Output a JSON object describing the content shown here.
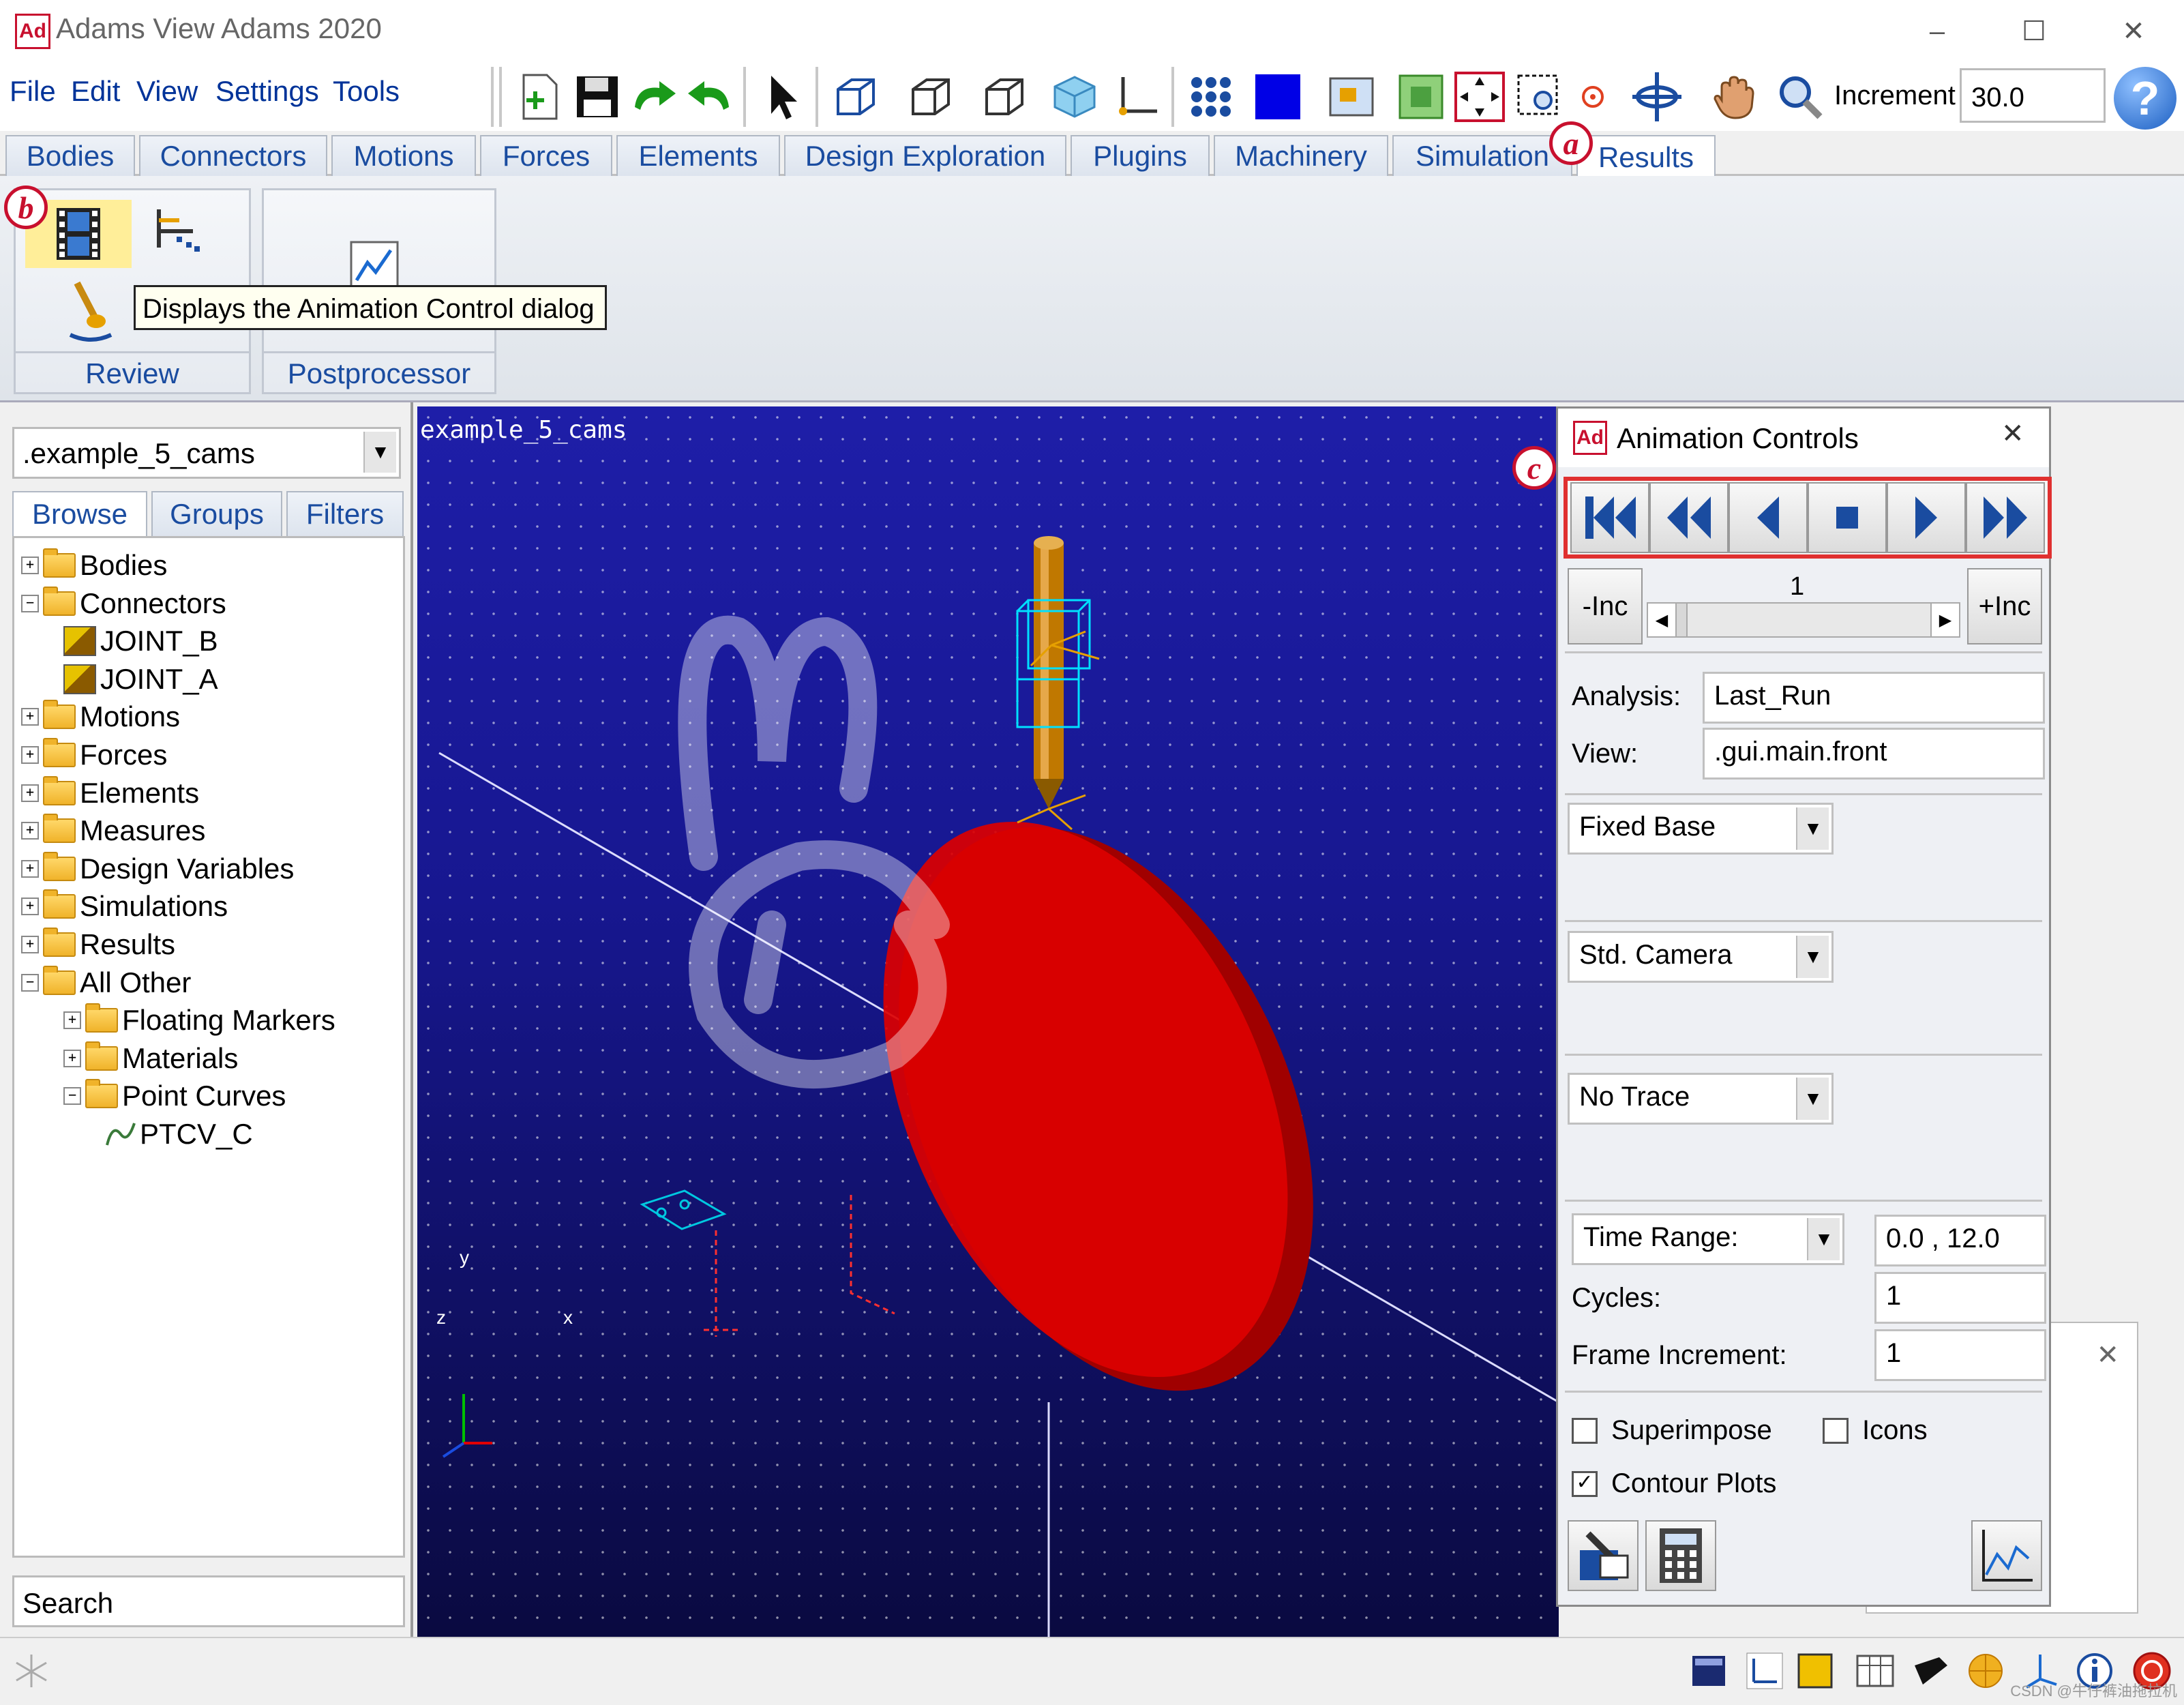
{
  "window": {
    "title": "Adams View Adams 2020",
    "app_badge": "Ad"
  },
  "menu": [
    "File",
    "Edit",
    "View",
    "Settings",
    "Tools"
  ],
  "toolbar": {
    "increment_label": "Increment",
    "increment_value": "30.0"
  },
  "ribbon_tabs": [
    "Bodies",
    "Connectors",
    "Motions",
    "Forces",
    "Elements",
    "Design Exploration",
    "Plugins",
    "Machinery",
    "Simulation",
    "Results"
  ],
  "ribbon_active_tab": "Results",
  "ribbon_groups": {
    "review": "Review",
    "postprocessor": "Postprocessor"
  },
  "tooltip": "Displays the Animation Control dialog",
  "annotations": {
    "a": "a",
    "b": "b",
    "c": "c"
  },
  "left_panel": {
    "model": ".example_5_cams",
    "tabs": [
      "Browse",
      "Groups",
      "Filters"
    ],
    "tree": [
      {
        "label": "Bodies",
        "level": 0,
        "exp": "+"
      },
      {
        "label": "Connectors",
        "level": 0,
        "exp": "-"
      },
      {
        "label": "JOINT_B",
        "level": 1,
        "icon": "joint"
      },
      {
        "label": "JOINT_A",
        "level": 1,
        "icon": "joint"
      },
      {
        "label": "Motions",
        "level": 0,
        "exp": "+"
      },
      {
        "label": "Forces",
        "level": 0,
        "exp": "+"
      },
      {
        "label": "Elements",
        "level": 0,
        "exp": "+"
      },
      {
        "label": "Measures",
        "level": 0,
        "exp": "+"
      },
      {
        "label": "Design Variables",
        "level": 0,
        "exp": "+"
      },
      {
        "label": "Simulations",
        "level": 0,
        "exp": "+"
      },
      {
        "label": "Results",
        "level": 0,
        "exp": "+"
      },
      {
        "label": "All Other",
        "level": 0,
        "exp": "-"
      },
      {
        "label": "Floating Markers",
        "level": 1,
        "exp": "+"
      },
      {
        "label": "Materials",
        "level": 1,
        "exp": "+"
      },
      {
        "label": "Point Curves",
        "level": 1,
        "exp": "-"
      },
      {
        "label": "PTCV_C",
        "level": 2,
        "icon": "curve"
      }
    ],
    "search_placeholder": "Search"
  },
  "viewport": {
    "name": "example_5_cams",
    "triad": {
      "y": "y",
      "z": "z",
      "x": "x"
    }
  },
  "animation_controls": {
    "title": "Animation Controls",
    "inc_minus": "-Inc",
    "inc_plus": "+Inc",
    "frame": "1",
    "analysis_label": "Analysis:",
    "analysis_value": "Last_Run",
    "view_label": "View:",
    "view_value": ".gui.main.front",
    "base": "Fixed Base",
    "camera": "Std. Camera",
    "trace": "No Trace",
    "time_range_label": "Time Range:",
    "time_range_value": "0.0 , 12.0",
    "cycles_label": "Cycles:",
    "cycles_value": "1",
    "frame_increment_label": "Frame Increment:",
    "frame_increment_value": "1",
    "superimpose": "Superimpose",
    "icons": "Icons",
    "contour_plots": "Contour Plots",
    "contour_plots_checked": true,
    "superimpose_checked": false,
    "icons_checked": false
  },
  "statusbar": {
    "watermark": "CSDN @牛仔裤油拖拉机"
  },
  "colors": {
    "accent": "#1a4ca0",
    "annotation": "#c8102e",
    "viewport_top": "#1e1ea8",
    "cam_red": "#d40000"
  }
}
